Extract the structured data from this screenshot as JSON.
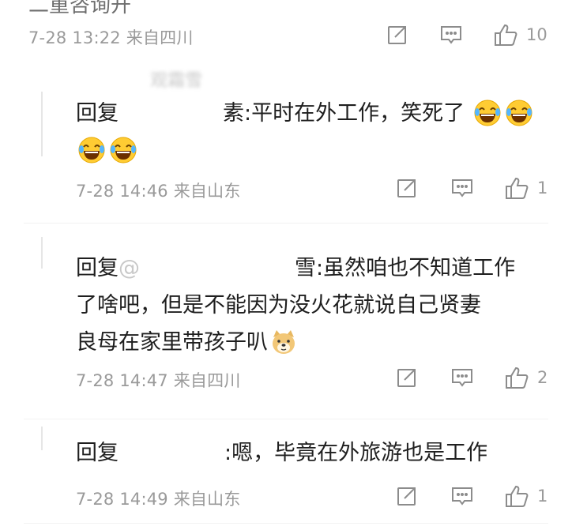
{
  "top_clipped_text": "二重咨询开",
  "c0": {
    "meta": "7-28 13:22 来自四川",
    "likes": "10"
  },
  "c1": {
    "blur_name": "观霜雪",
    "prefix": "回复",
    "after_redact": "素:",
    "line1": "平时在外工作，笑死了",
    "meta": "7-28 14:46 来自山东",
    "likes": "1"
  },
  "c2": {
    "prefix": "回复",
    "at": "@",
    "after_redact": "雪:",
    "line1": "虽然咱也不知道工作",
    "line2": "了啥吧，但是不能因为没火花就说自己贤妻",
    "line3": "良母在家里带孩子叭",
    "meta": "7-28 14:47 来自四川",
    "likes": "2"
  },
  "c3": {
    "prefix": "回复",
    "after_redact": ":嗯，毕竟在外旅游也是工作",
    "meta": "7-28 14:49 来自山东",
    "likes": "1"
  },
  "icons": [
    "share-icon",
    "comment-icon",
    "like-icon",
    "laughing-tears-emoji-icon",
    "doge-emoji-icon"
  ]
}
